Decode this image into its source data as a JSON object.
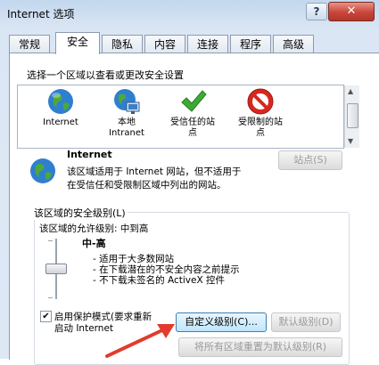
{
  "window": {
    "title": "Internet 选项",
    "help_label": "?",
    "close_label": "✕"
  },
  "tabs": [
    {
      "label": "常规"
    },
    {
      "label": "安全"
    },
    {
      "label": "隐私"
    },
    {
      "label": "内容"
    },
    {
      "label": "连接"
    },
    {
      "label": "程序"
    },
    {
      "label": "高级"
    }
  ],
  "security": {
    "prompt": "选择一个区域以查看或更改安全设置",
    "zones": [
      {
        "label": "Internet",
        "icon": "globe-icon"
      },
      {
        "label": "本地\nIntranet",
        "icon": "intranet-globe-icon"
      },
      {
        "label": "受信任的站\n点",
        "icon": "green-check-icon"
      },
      {
        "label": "受限制的站\n点",
        "icon": "no-entry-icon"
      }
    ],
    "selected_zone_title": "Internet",
    "selected_zone_desc_1": "该区域适用于 Internet 网站，但不适用于",
    "selected_zone_desc_2": "在受信任和受限制区域中列出的网站。",
    "sites_button": "站点(S)"
  },
  "level": {
    "group_title": "该区域的安全级别(L)",
    "allowed_levels": "该区域的允许级别: 中到高",
    "level_name": "中-高",
    "bullets": [
      "- 适用于大多数网站",
      "- 在下载潜在的不安全内容之前提示",
      "- 不下载未签名的 ActiveX 控件"
    ],
    "protected_mode_label_1": "启用保护模式(要求重新",
    "protected_mode_label_2": "启动 Internet",
    "protected_mode_checked": true,
    "custom_level_button": "自定义级别(C)...",
    "default_level_button": "默认级别(D)",
    "reset_all_button": "将所有区域重置为默认级别(R)"
  },
  "colors": {
    "annotation_arrow": "#e23b2e",
    "title_bar": "#c3d7ee"
  }
}
